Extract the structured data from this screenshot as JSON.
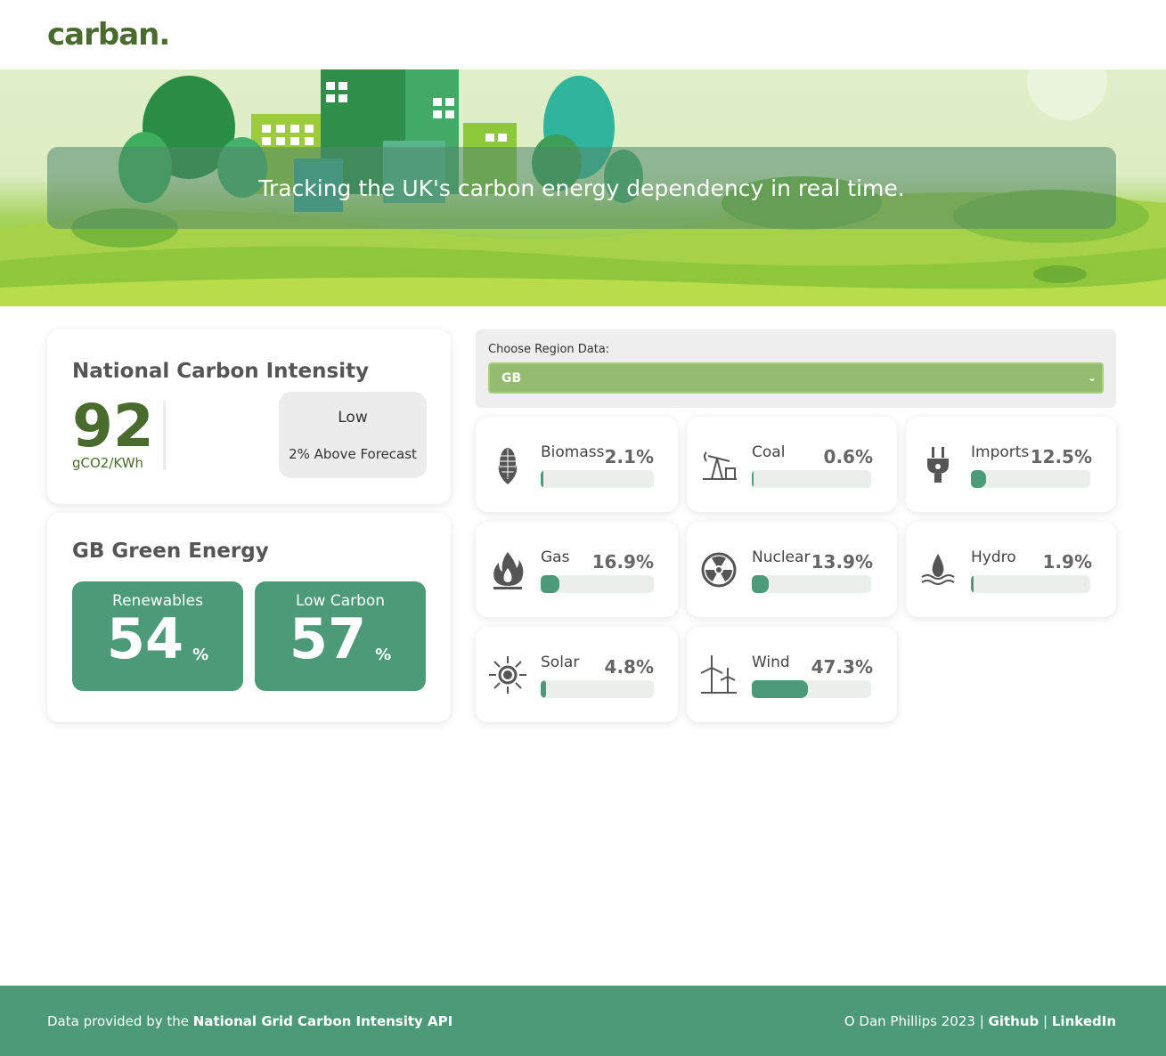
{
  "header": {
    "logo": "carban."
  },
  "hero": {
    "tagline": "Tracking the UK's carbon energy dependency in real time."
  },
  "national": {
    "title": "National Carbon Intensity",
    "value": "92",
    "unit": "gCO2/KWh",
    "level": "Low",
    "forecast": "2% Above Forecast"
  },
  "green": {
    "title": "GB Green Energy",
    "renewables_label": "Renewables",
    "renewables_value": "54",
    "low_carbon_label": "Low Carbon",
    "low_carbon_value": "57",
    "percent_sign": "%"
  },
  "region": {
    "label": "Choose Region Data:",
    "selected": "GB",
    "chevron_icon": "chevron-down-icon"
  },
  "fuels": [
    {
      "name": "Biomass",
      "pct_text": "2.1%",
      "value": 2.1,
      "icon": "corn-icon"
    },
    {
      "name": "Coal",
      "pct_text": "0.6%",
      "value": 0.6,
      "icon": "oil-pump-icon"
    },
    {
      "name": "Imports",
      "pct_text": "12.5%",
      "value": 12.5,
      "icon": "plug-icon"
    },
    {
      "name": "Gas",
      "pct_text": "16.9%",
      "value": 16.9,
      "icon": "flame-icon"
    },
    {
      "name": "Nuclear",
      "pct_text": "13.9%",
      "value": 13.9,
      "icon": "radiation-icon"
    },
    {
      "name": "Hydro",
      "pct_text": "1.9%",
      "value": 1.9,
      "icon": "water-drop-icon"
    },
    {
      "name": "Solar",
      "pct_text": "4.8%",
      "value": 4.8,
      "icon": "sun-icon"
    },
    {
      "name": "Wind",
      "pct_text": "47.3%",
      "value": 47.3,
      "icon": "wind-turbine-icon"
    }
  ],
  "footer": {
    "left_prefix": "Data provided by the",
    "left_link": "National Grid Carbon Intensity API",
    "copyright": "O Dan Phillips 2023 |",
    "github": "Github",
    "separator": "|",
    "linkedin": "LinkedIn"
  },
  "colors": {
    "brand": "#4a6b2e",
    "accent": "#4d9a78",
    "select": "#94bb70"
  }
}
